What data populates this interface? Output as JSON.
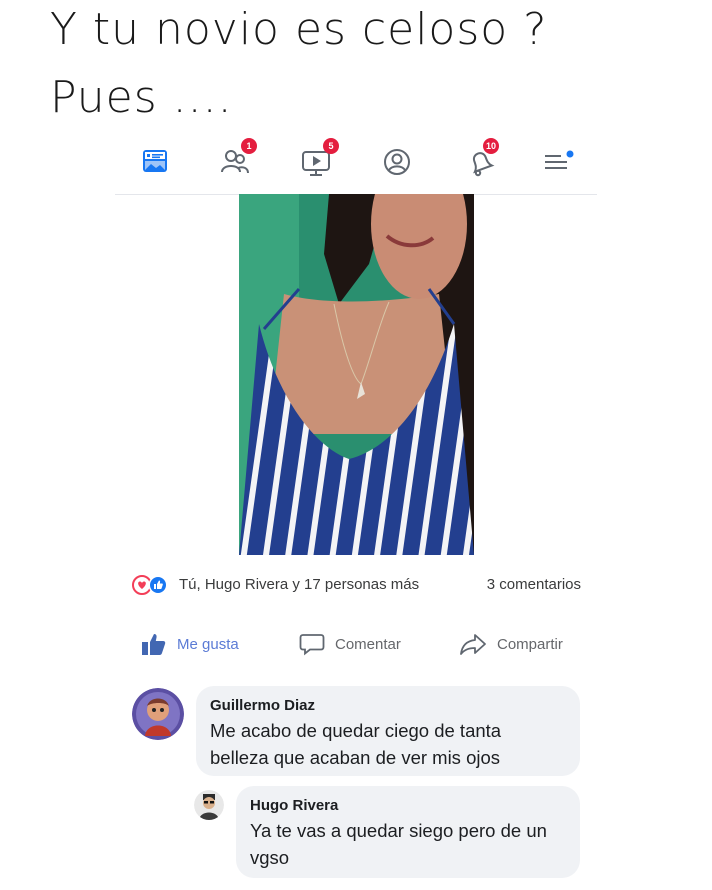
{
  "caption": {
    "line1": "Y tu novio es celoso ?",
    "line2": "Pues ...."
  },
  "navbar": {
    "items": [
      {
        "icon": "news-feed-icon",
        "badge": ""
      },
      {
        "icon": "friends-icon",
        "badge": "1"
      },
      {
        "icon": "watch-video-icon",
        "badge": "5"
      },
      {
        "icon": "profile-icon",
        "badge": ""
      },
      {
        "icon": "notifications-bell-icon",
        "badge": "10"
      },
      {
        "icon": "menu-icon",
        "badge": ""
      }
    ],
    "badge_color": "#e41e3f",
    "active_color": "#1877f2"
  },
  "post": {
    "reactions_text": "Tú, Hugo Rivera y 17 personas más",
    "comments_count": "3 comentarios",
    "actions": {
      "like": "Me gusta",
      "comment": "Comentar",
      "share": "Compartir"
    }
  },
  "comments": [
    {
      "author": "Guillermo Diaz",
      "text": "Me acabo de quedar ciego de tanta belleza que acaban de ver mis ojos"
    },
    {
      "author": "Hugo Rivera",
      "text": "Ya te vas a quedar siego  pero de un vgso"
    }
  ]
}
